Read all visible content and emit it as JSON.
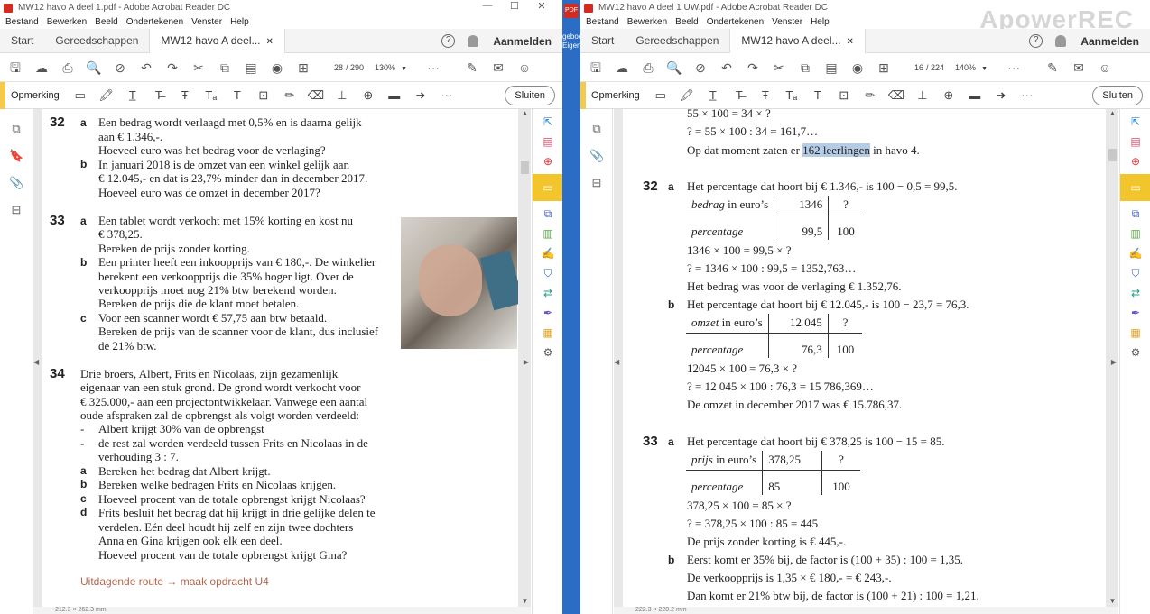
{
  "left": {
    "title": "MW12 havo A deel 1.pdf - Adobe Acrobat Reader DC",
    "menu": [
      "Bestand",
      "Bewerken",
      "Beeld",
      "Ondertekenen",
      "Venster",
      "Help"
    ],
    "tabs": {
      "start": "Start",
      "tools": "Gereedschappen",
      "doc": "MW12 havo A deel..."
    },
    "signin": "Aanmelden",
    "page_current": "28",
    "page_total": "/ 290",
    "zoom": "130%",
    "annot_label": "Opmerking",
    "close_label": "Sluiten",
    "status": "212.3 × 262.3 mm",
    "q32": {
      "num": "32",
      "a_label": "a",
      "a1": "Een bedrag wordt verlaagd met 0,5% en is daarna gelijk",
      "a2": "aan € 1.346,-.",
      "a3": "Hoeveel euro was het bedrag voor de verlaging?",
      "b_label": "b",
      "b1": "In januari 2018 is de omzet van een winkel gelijk aan",
      "b2": "€ 12.045,- en dat is 23,7% minder dan in december 2017.",
      "b3": "Hoeveel euro was de omzet in december 2017?"
    },
    "q33": {
      "num": "33",
      "a_label": "a",
      "a1": "Een tablet wordt verkocht met 15% korting en kost nu",
      "a2": "€ 378,25.",
      "a3": "Bereken de prijs zonder korting.",
      "b_label": "b",
      "b1": "Een printer heeft een inkoopprijs van € 180,-. De winkelier",
      "b2": "berekent een verkoopprijs die 35% hoger ligt. Over de",
      "b3": "verkoopprijs moet nog 21% btw berekend worden.",
      "b4": "Bereken de prijs die de klant moet betalen.",
      "c_label": "c",
      "c1": "Voor een scanner wordt € 57,75 aan btw betaald.",
      "c2": "Bereken de prijs van de scanner voor de klant, dus inclusief",
      "c3": "de 21% btw."
    },
    "q34": {
      "num": "34",
      "l1": "Drie broers, Albert, Frits en Nicolaas, zijn gezamenlijk",
      "l2": "eigenaar van een stuk grond. De grond wordt verkocht voor",
      "l3": "€ 325.000,- aan een projectontwikkelaar. Vanwege een aantal",
      "l4": "oude afspraken zal de opbrengst als volgt worden verdeeld:",
      "d1": "Albert krijgt 30% van de opbrengst",
      "d2": "de rest zal worden verdeeld tussen Frits en Nicolaas in de",
      "d3": "verhouding 3 : 7.",
      "a_label": "a",
      "a": "Bereken het bedrag dat Albert krijgt.",
      "b_label": "b",
      "b": "Bereken welke bedragen Frits en Nicolaas krijgen.",
      "c_label": "c",
      "c": "Hoeveel procent van de totale opbrengst krijgt Nicolaas?",
      "d_label": "d",
      "d_1": "Frits besluit het bedrag dat hij krijgt in drie gelijke delen te",
      "d_2": "verdelen. Eén deel houdt hij zelf en zijn twee dochters",
      "d_3": "Anna en Gina krijgen ook elk een deel.",
      "d_4": "Hoeveel procent van de totale opbrengst krijgt Gina?"
    },
    "route": "Uitdagende route → maak opdracht U4"
  },
  "strip": {
    "text": "geboe Eigen"
  },
  "right": {
    "title": "MW12 havo A deel 1 UW.pdf - Adobe Acrobat Reader DC",
    "menu": [
      "Bestand",
      "Bewerken",
      "Beeld",
      "Ondertekenen",
      "Venster",
      "Help"
    ],
    "tabs": {
      "start": "Start",
      "tools": "Gereedschappen",
      "doc": "MW12 havo A deel..."
    },
    "signin": "Aanmelden",
    "page_current": "16",
    "page_total": "/ 224",
    "zoom": "140%",
    "annot_label": "Opmerking",
    "close_label": "Sluiten",
    "status": "222.3 × 220.2 mm",
    "watermark": "ApowerREC",
    "top": {
      "l1": "55 × 100 = 34 × ?",
      "l2": "? = 55 × 100 : 34 = 161,7…",
      "l3a": "Op dat moment zaten er ",
      "l3b": "162 leerlingen",
      "l3c": " in havo 4."
    },
    "a32": {
      "num": "32",
      "a_label": "a",
      "a1": "Het percentage dat hoort bij € 1.346,- is 100 − 0,5 = 99,5.",
      "t1": {
        "h1": "bedrag",
        "h1s": " in euro’s",
        "h2": "1346",
        "h3": "?",
        "r1": "percentage",
        "r2": "99,5",
        "r3": "100"
      },
      "a2": "1346 × 100 = 99,5 × ?",
      "a3": "? = 1346 × 100 : 99,5 = 1352,763…",
      "a4": "Het bedrag was voor de verlaging € 1.352,76.",
      "b_label": "b",
      "b1": "Het percentage dat hoort bij € 12.045,- is 100 − 23,7 = 76,3.",
      "t2": {
        "h1": "omzet",
        "h1s": " in euro’s",
        "h2": "12 045",
        "h3": "?",
        "r1": "percentage",
        "r2": "76,3",
        "r3": "100"
      },
      "b2": "12045 × 100 = 76,3 × ?",
      "b3": "? = 12 045 × 100 : 76,3 = 15 786,369…",
      "b4": "De omzet in december 2017 was € 15.786,37."
    },
    "a33": {
      "num": "33",
      "a_label": "a",
      "a1": "Het percentage dat hoort bij € 378,25 is 100 − 15 = 85.",
      "t1": {
        "h1": "prijs",
        "h1s": " in euro’s",
        "h2": "378,25",
        "h3": "?",
        "r1": "percentage",
        "r2": "85",
        "r3": "100"
      },
      "a2": "378,25 × 100 = 85 × ?",
      "a3": "? = 378,25 × 100 : 85 = 445",
      "a4": "De prijs zonder korting is € 445,-.",
      "b_label": "b",
      "b1": "Eerst komt er 35% bij, de factor is (100 + 35) : 100 = 1,35.",
      "b2": "De verkoopprijs is 1,35 × € 180,- = € 243,-.",
      "b3": "Dan komt er 21% btw bij, de factor is (100 + 21) : 100 = 1,21."
    }
  }
}
